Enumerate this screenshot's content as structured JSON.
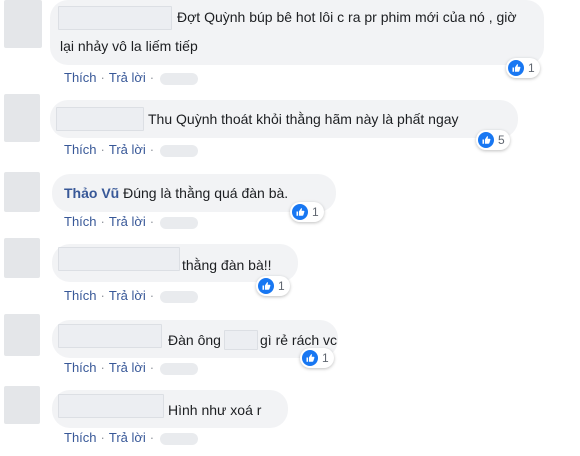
{
  "comments": [
    {
      "author": "",
      "lines": [
        "Đợt Quỳnh búp bê hot lôi c ra pr phim mới của nó , giờ",
        "lại nhảy vô la liếm tiếp"
      ],
      "like_label": "Thích",
      "reply_label": "Trả lời",
      "reaction_count": "1"
    },
    {
      "author": "",
      "lines": [
        "Thu Quỳnh thoát khỏi thằng hãm này là phất ngay"
      ],
      "like_label": "Thích",
      "reply_label": "Trả lời",
      "reaction_count": "5"
    },
    {
      "author": "Thảo Vũ",
      "lines": [
        "Đúng là thằng quá đàn bà."
      ],
      "like_label": "Thích",
      "reply_label": "Trả lời",
      "reaction_count": "1"
    },
    {
      "author": "",
      "lines": [
        "thằng đàn bà!!"
      ],
      "like_label": "Thích",
      "reply_label": "Trả lời",
      "reaction_count": "1"
    },
    {
      "author": "",
      "lines": [
        "Đàn ông",
        "gì rẻ rách vc"
      ],
      "like_label": "Thích",
      "reply_label": "Trả lời",
      "reaction_count": "1"
    },
    {
      "author": "",
      "lines": [
        "Hình như xoá r"
      ],
      "like_label": "Thích",
      "reply_label": "Trả lời",
      "reaction_count": ""
    }
  ],
  "icons": {
    "reaction": "like-thumb-icon",
    "avatar": "avatar"
  },
  "colors": {
    "link": "#385898",
    "bubble": "#f2f3f5",
    "like_blue": "#1877f2"
  }
}
